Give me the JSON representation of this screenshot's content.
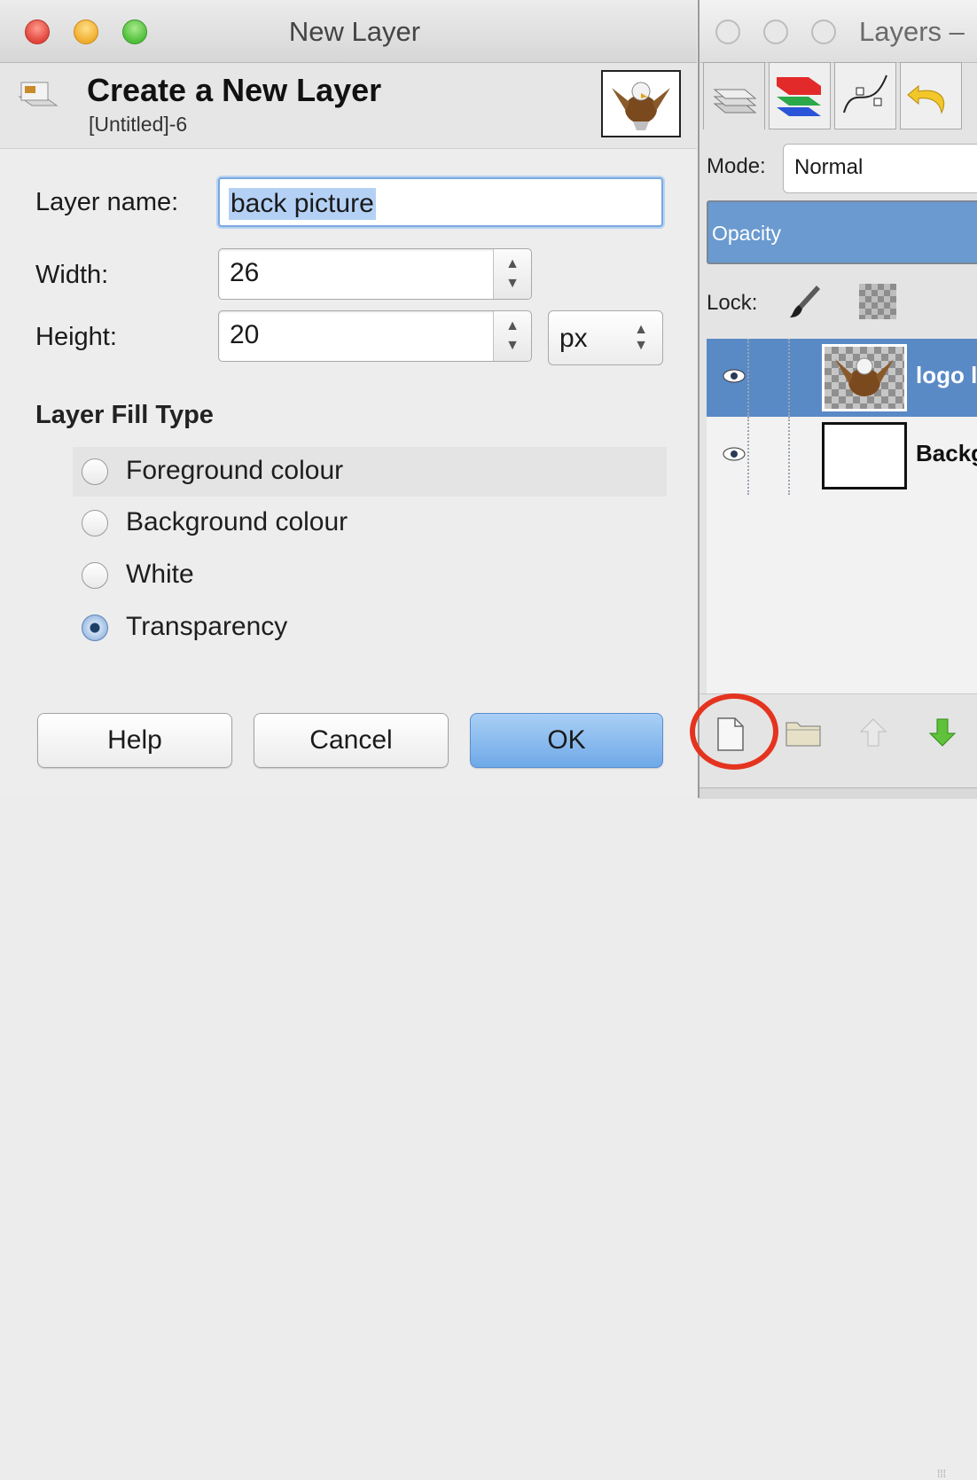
{
  "dialog": {
    "window_title": "New Layer",
    "header_title": "Create a New Layer",
    "header_subtitle": "[Untitled]-6",
    "layer_name_label": "Layer name:",
    "layer_name_value": "back picture",
    "width_label": "Width:",
    "width_value": "26",
    "height_label": "Height:",
    "height_value": "20",
    "unit_value": "px",
    "fill_type_heading": "Layer Fill Type",
    "fill_options": [
      {
        "label": "Foreground colour",
        "selected": false
      },
      {
        "label": "Background colour",
        "selected": false
      },
      {
        "label": "White",
        "selected": false
      },
      {
        "label": "Transparency",
        "selected": true
      }
    ],
    "buttons": {
      "help": "Help",
      "cancel": "Cancel",
      "ok": "OK"
    }
  },
  "layers_panel": {
    "window_title": "Layers –",
    "mode_label": "Mode:",
    "mode_value": "Normal",
    "opacity_label": "Opacity",
    "lock_label": "Lock:",
    "layers": [
      {
        "name": "logo l",
        "selected": true
      },
      {
        "name": "Backg",
        "selected": false
      }
    ],
    "bottom_icons": [
      "new-layer-icon",
      "new-layer-group-icon",
      "raise-layer-icon",
      "lower-layer-icon"
    ]
  },
  "colors": {
    "ok_button": "#6fa9e8",
    "selection_blue": "#5a8ac6",
    "highlight_circle": "#e4341f"
  }
}
